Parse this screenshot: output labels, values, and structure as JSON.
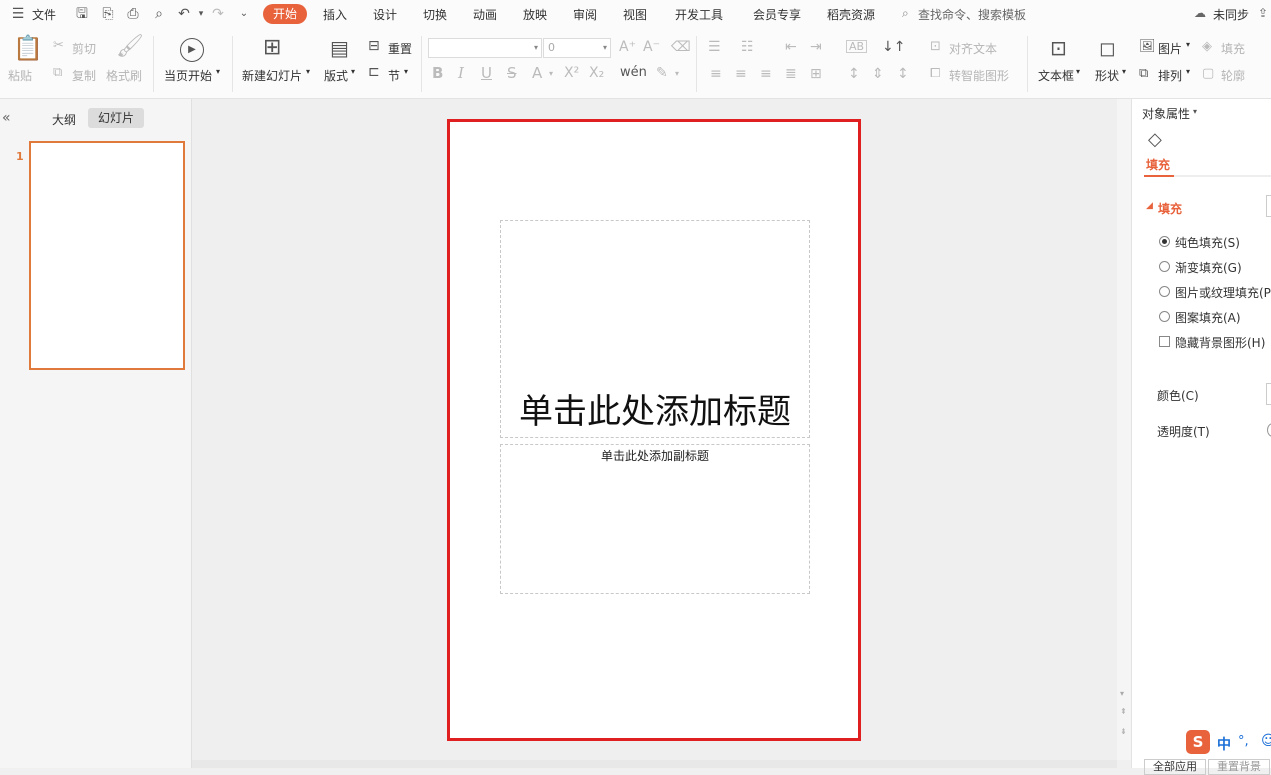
{
  "menu": {
    "file": "文件",
    "tabs": [
      "开始",
      "插入",
      "设计",
      "切换",
      "动画",
      "放映",
      "审阅",
      "视图",
      "开发工具",
      "会员专享",
      "稻壳资源"
    ],
    "search_placeholder": "查找命令、搜索模板",
    "sync_status": "未同步"
  },
  "ribbon": {
    "paste": "粘贴",
    "cut": "剪切",
    "copy": "复制",
    "format_painter": "格式刷",
    "from_start": "当页开始",
    "new_slide": "新建幻灯片",
    "layout": "版式",
    "reset": "重置",
    "section": "节",
    "font_size": "0",
    "align_text": "对齐文本",
    "smart_shape": "转智能图形",
    "textbox": "文本框",
    "shape": "形状",
    "picture": "图片",
    "arrange": "排列",
    "fill": "填充",
    "outline": "轮廓"
  },
  "left_panel": {
    "tab_outline": "大纲",
    "tab_slides": "幻灯片",
    "slide_number": "1"
  },
  "slide": {
    "title_placeholder": "单击此处添加标题",
    "subtitle_placeholder": "单击此处添加副标题"
  },
  "right_panel": {
    "header": "对象属性",
    "tab_fill": "填充",
    "section_fill": "填充",
    "options": [
      {
        "label": "纯色填充(S)",
        "selected": true
      },
      {
        "label": "渐变填充(G)",
        "selected": false
      },
      {
        "label": "图片或纹理填充(P",
        "selected": false
      },
      {
        "label": "图案填充(A)",
        "selected": false
      }
    ],
    "hide_bg": "隐藏背景图形(H)",
    "color_label": "颜色(C)",
    "transparency_label": "透明度(T)",
    "apply_all": "全部应用",
    "reset_bg": "重置背景"
  },
  "ime": {
    "lang": "中",
    "punct": "°,"
  },
  "colors": {
    "accent": "#e8623c",
    "slide_border": "#e02020",
    "thumb_border": "#e07a3c"
  }
}
